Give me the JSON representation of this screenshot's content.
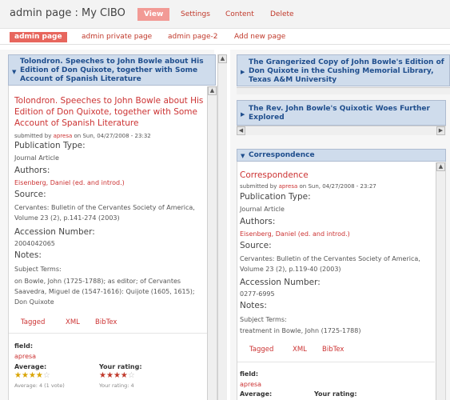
{
  "header": {
    "title": "admin page : My CIBO",
    "tabs": [
      {
        "label": "View",
        "active": true
      },
      {
        "label": "Settings",
        "active": false
      },
      {
        "label": "Content",
        "active": false
      },
      {
        "label": "Delete",
        "active": false
      }
    ]
  },
  "subtabs": [
    {
      "label": "admin page",
      "active": true
    },
    {
      "label": "admin private page",
      "active": false
    },
    {
      "label": "admin page-2",
      "active": false
    },
    {
      "label": "Add new page",
      "active": false
    }
  ],
  "left_panel": {
    "header": "Tolondron. Speeches to John Bowle about His Edition of Don Quixote, together with Some Account of Spanish Literature",
    "node_title": "Tolondron. Speeches to John Bowle about His Edition of Don Quixote, together with Some Account of Spanish Literature",
    "submitted_prefix": "submitted by",
    "submitted_user": "apresa",
    "submitted_suffix": "on Sun, 04/27/2008 - 23:32",
    "publication_type_label": "Publication Type:",
    "publication_type": "Journal Article",
    "authors_label": "Authors:",
    "authors": "Eisenberg, Daniel (ed. and introd.)",
    "source_label": "Source:",
    "source": "Cervantes: Bulletin of the Cervantes Society of America, Volume 23 (2), p.141-274 (2003)",
    "accession_label": "Accession Number:",
    "accession": "2004042065",
    "notes_label": "Notes:",
    "subject_terms_label": "Subject Terms:",
    "subject_terms": "on Bowle, John (1725-1788); as editor; of Cervantes Saavedra, Miguel de (1547-1616): Quijote (1605, 1615); Don Quixote",
    "links": [
      "Tagged",
      "XML",
      "BibTex"
    ],
    "field_label": "field:",
    "field_value": "apresa",
    "average_label": "Average:",
    "average_rating": 4,
    "average_caption": "Average: 4 (1 vote)",
    "your_rating_label": "Your rating:",
    "your_rating": 4,
    "your_rating_caption": "Your rating: 4"
  },
  "right_panels": [
    {
      "header": "The Grangerized Copy of John Bowle's Edition of Don Quixote in the Cushing Memorial Library, Texas A&M University"
    },
    {
      "header": "The Rev. John Bowle's Quixotic Woes Further Explored"
    }
  ],
  "correspondence": {
    "header": "Correspondence",
    "node_title": "Correspondence",
    "submitted_prefix": "submitted by",
    "submitted_user": "apresa",
    "submitted_suffix": "on Sun, 04/27/2008 - 23:27",
    "publication_type_label": "Publication Type:",
    "publication_type": "Journal Article",
    "authors_label": "Authors:",
    "authors": "Eisenberg, Daniel (ed. and introd.)",
    "source_label": "Source:",
    "source": "Cervantes: Bulletin of the Cervantes Society of America, Volume 23 (2), p.119-40 (2003)",
    "accession_label": "Accession Number:",
    "accession": "0277-6995",
    "notes_label": "Notes:",
    "subject_terms_label": "Subject Terms:",
    "subject_terms": "treatment in Bowle, John (1725-1788)",
    "links": [
      "Tagged",
      "XML",
      "BibTex"
    ],
    "field_label": "field:",
    "field_value": "apresa",
    "average_label": "Average:",
    "your_rating_label": "Your rating:"
  },
  "icons": {
    "collapse": "triangle-down-icon",
    "expand": "triangle-right-icon",
    "scroll_up": "arrow-up-icon",
    "scroll_left": "arrow-left-icon",
    "scroll_right": "arrow-right-icon"
  },
  "colors": {
    "accent": "#cc3333",
    "active_tab": "#f29a95",
    "panel_header_bg": "#cfdcec",
    "panel_header_text": "#1f4e8d"
  }
}
